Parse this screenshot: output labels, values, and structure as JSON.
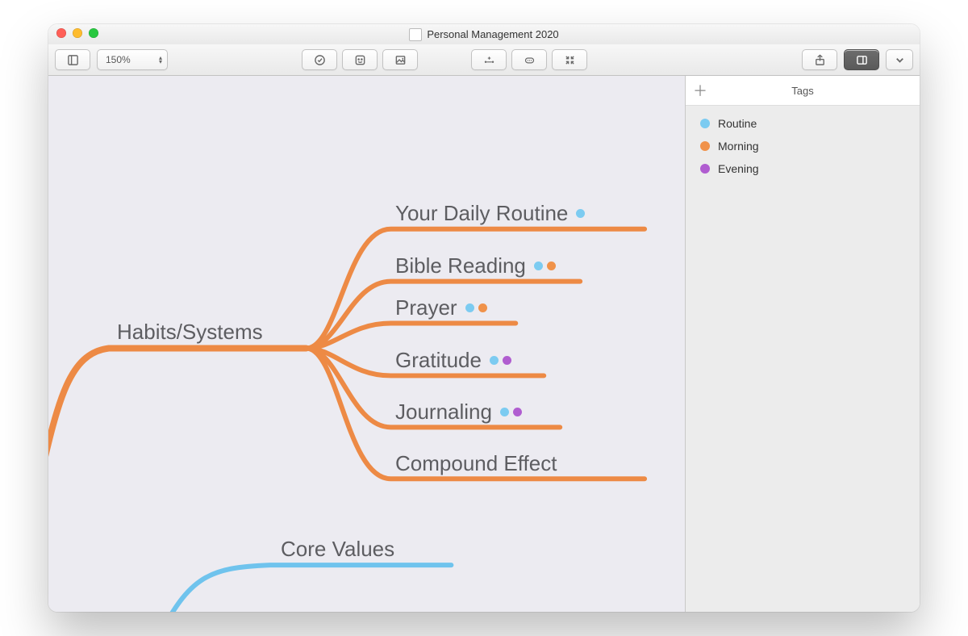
{
  "window": {
    "title": "Personal Management 2020"
  },
  "toolbar": {
    "zoom_label": "150%"
  },
  "sidebar": {
    "title": "Tags",
    "tags": [
      {
        "label": "Routine",
        "color": "routine"
      },
      {
        "label": "Morning",
        "color": "morning"
      },
      {
        "label": "Evening",
        "color": "evening"
      }
    ]
  },
  "mindmap": {
    "branch_color": "#ed8a45",
    "alt_branch_color": "#6fc3ed",
    "root": {
      "label": "Habits/Systems"
    },
    "children": [
      {
        "label": "Your Daily Routine",
        "tags": [
          "routine"
        ]
      },
      {
        "label": "Bible Reading",
        "tags": [
          "routine",
          "morning"
        ]
      },
      {
        "label": "Prayer",
        "tags": [
          "routine",
          "morning"
        ]
      },
      {
        "label": "Gratitude",
        "tags": [
          "routine",
          "evening"
        ]
      },
      {
        "label": "Journaling",
        "tags": [
          "routine",
          "evening"
        ]
      },
      {
        "label": "Compound Effect",
        "tags": []
      }
    ],
    "siblings": [
      {
        "label": "Core Values",
        "color": "alt"
      }
    ]
  }
}
